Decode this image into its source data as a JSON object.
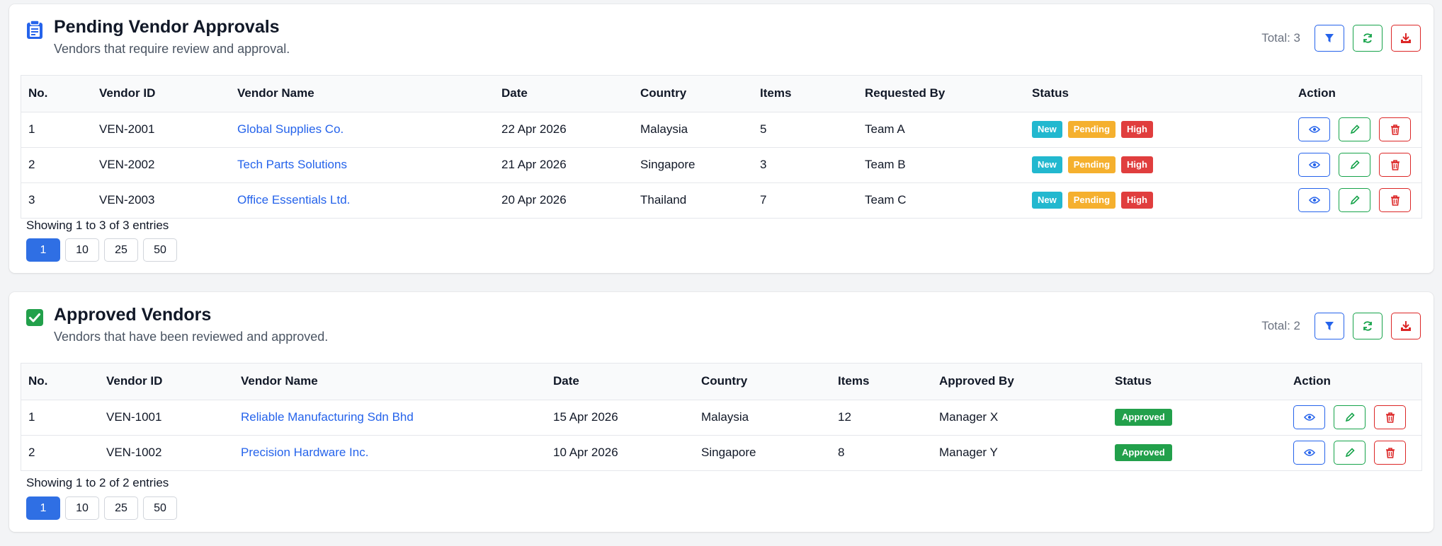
{
  "pending": {
    "title": "Pending Vendor Approvals",
    "subtitle": "Vendors that require review and approval.",
    "total": "Total: 3",
    "columns": [
      "No.",
      "Vendor ID",
      "Vendor Name",
      "Date",
      "Country",
      "Items",
      "Requested By",
      "Status",
      "Action"
    ],
    "rows": [
      {
        "no": "1",
        "id": "VEN-2001",
        "name": "Global Supplies Co.",
        "date": "22 Apr 2026",
        "country": "Malaysia",
        "items": "5",
        "by": "Team A"
      },
      {
        "no": "2",
        "id": "VEN-2002",
        "name": "Tech Parts Solutions",
        "date": "21 Apr 2026",
        "country": "Singapore",
        "items": "3",
        "by": "Team B"
      },
      {
        "no": "3",
        "id": "VEN-2003",
        "name": "Office Essentials Ltd.",
        "date": "20 Apr 2026",
        "country": "Thailand",
        "items": "7",
        "by": "Team C"
      }
    ],
    "badges": {
      "new": "New",
      "pending": "Pending",
      "high": "High"
    },
    "info": "Showing 1 to 3 of 3 entries",
    "pages": [
      "1",
      "10",
      "25",
      "50"
    ]
  },
  "approved": {
    "title": "Approved Vendors",
    "subtitle": "Vendors that have been reviewed and approved.",
    "total": "Total: 2",
    "columns": [
      "No.",
      "Vendor ID",
      "Vendor Name",
      "Date",
      "Country",
      "Items",
      "Approved By",
      "Status",
      "Action"
    ],
    "rows": [
      {
        "no": "1",
        "id": "VEN-1001",
        "name": "Reliable Manufacturing Sdn Bhd",
        "date": "15 Apr 2026",
        "country": "Malaysia",
        "items": "12",
        "by": "Manager X"
      },
      {
        "no": "2",
        "id": "VEN-1002",
        "name": "Precision Hardware Inc.",
        "date": "10 Apr 2026",
        "country": "Singapore",
        "items": "8",
        "by": "Manager Y"
      }
    ],
    "badges": {
      "approved": "Approved"
    },
    "info": "Showing 1 to 2 of 2 entries",
    "pages": [
      "1",
      "10",
      "25",
      "50"
    ]
  },
  "icons": {
    "pending_header": "clipboard-icon",
    "approved_header": "check-square-icon",
    "filter": "filter-icon",
    "refresh": "refresh-icon",
    "download": "download-icon",
    "view": "eye-icon",
    "edit": "pencil-icon",
    "delete": "trash-icon"
  },
  "colors": {
    "accent": "#2563eb",
    "success": "#16a34a",
    "danger": "#dc2626",
    "badge_new": "#22b8cf",
    "badge_pending": "#f5b02e",
    "badge_high": "#e03e3e",
    "badge_approved": "#22a04b"
  }
}
